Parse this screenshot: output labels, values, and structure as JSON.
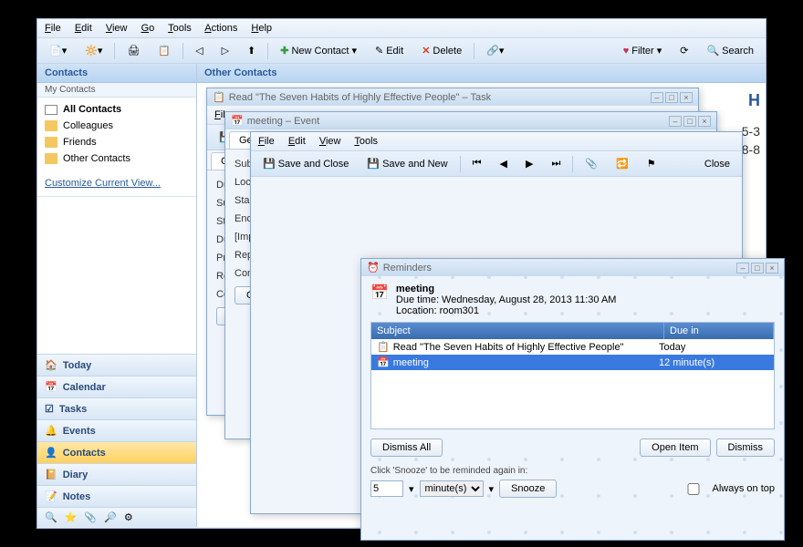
{
  "menubar": [
    "File",
    "Edit",
    "View",
    "Go",
    "Tools",
    "Actions",
    "Help"
  ],
  "toolbar": {
    "new_contact": "New Contact",
    "edit": "Edit",
    "delete": "Delete",
    "filter": "Filter",
    "search": "Search"
  },
  "sidebar": {
    "header": "Contacts",
    "sub": "My Contacts",
    "items": [
      {
        "label": "All Contacts",
        "bold": true,
        "icon": "card"
      },
      {
        "label": "Colleagues",
        "icon": "folder"
      },
      {
        "label": "Friends",
        "icon": "folder"
      },
      {
        "label": "Other Contacts",
        "icon": "folder"
      }
    ],
    "customize": "Customize Current View...",
    "nav": [
      {
        "label": "Today",
        "icon": "home"
      },
      {
        "label": "Calendar",
        "icon": "calendar"
      },
      {
        "label": "Tasks",
        "icon": "tasks"
      },
      {
        "label": "Events",
        "icon": "events"
      },
      {
        "label": "Contacts",
        "icon": "contacts",
        "active": true
      },
      {
        "label": "Diary",
        "icon": "diary"
      },
      {
        "label": "Notes",
        "icon": "notes"
      }
    ]
  },
  "content": {
    "header": "Other Contacts",
    "letters": [
      "H"
    ]
  },
  "win1": {
    "title": "Read \"The Seven Habits of Highly Effective People\" – Task",
    "tab": "General",
    "fields": [
      "Due",
      "Subject",
      "Start",
      "Due d",
      "Priority",
      "Re",
      "Comm"
    ],
    "done_btn": "Done..."
  },
  "win2": {
    "title": "meeting – Event",
    "menubar": [
      "File"
    ],
    "tab": "General",
    "fields": [
      "Subject",
      "Location",
      "Start time",
      "End time",
      "[Importa",
      "Repe",
      "Commen"
    ],
    "contact_btn": "Contact..."
  },
  "win3": {
    "menubar": [
      "File",
      "Edit",
      "View",
      "Tools"
    ],
    "toolbar": {
      "save_close": "Save and Close",
      "save_new": "Save and New",
      "close": "Close"
    }
  },
  "reminders": {
    "title": "Reminders",
    "item_title": "meeting",
    "due_time": "Due time: Wednesday, August 28, 2013 11:30 AM",
    "location": "Location: room301",
    "cols": {
      "subject": "Subject",
      "due_in": "Due in"
    },
    "rows": [
      {
        "subject": "Read \"The Seven Habits of Highly Effective People\"",
        "due": "Today",
        "sel": false
      },
      {
        "subject": "meeting",
        "due": "12 minute(s)",
        "sel": true
      }
    ],
    "dismiss_all": "Dismiss All",
    "open_item": "Open Item",
    "dismiss": "Dismiss",
    "snooze_label": "Click 'Snooze' to be reminded again in:",
    "snooze_value": "5",
    "snooze_unit": "minute(s)",
    "snooze_btn": "Snooze",
    "always_on_top": "Always on top"
  }
}
